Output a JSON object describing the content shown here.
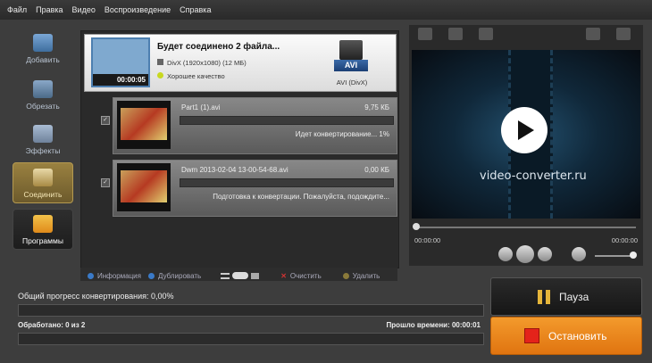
{
  "menu": [
    "Файл",
    "Правка",
    "Видео",
    "Воспроизведение",
    "Справка"
  ],
  "sidebar": {
    "items": [
      {
        "label": "Добавить",
        "icon": "add-video-icon"
      },
      {
        "label": "Обрезать",
        "icon": "cut-icon"
      },
      {
        "label": "Эффекты",
        "icon": "effects-icon"
      },
      {
        "label": "Соединить",
        "icon": "join-icon",
        "active": true
      },
      {
        "label": "Программы",
        "icon": "programs-icon"
      }
    ]
  },
  "group": {
    "title": "Будет соединено 2 файла...",
    "format_line": "DivX (1920x1080) (12 МБ)",
    "quality": "Хорошее качество",
    "thumb_time": "00:00:05",
    "profile_badge": "AVI",
    "profile_label": "AVI (DivX)"
  },
  "files": [
    {
      "name": "Part1 (1).avi",
      "size": "9,75 КБ",
      "status": "Идет конвертирование... 1%",
      "progress": 0.01
    },
    {
      "name": "Dwm 2013-02-04 13-00-54-68.avi",
      "size": "0,00 КБ",
      "status": "Подготовка к конвертации. Пожалуйста, подождите...",
      "progress": 0
    }
  ],
  "file_toolbar": {
    "info": "Информация",
    "duplicate": "Дублировать",
    "clear": "Очистить",
    "delete": "Удалить"
  },
  "preview": {
    "watermark": "video-converter.ru",
    "time_start": "00:00:00",
    "time_end": "00:00:00"
  },
  "progress": {
    "overall": "Общий прогресс конвертирования: 0,00%",
    "processed": "Обработано: 0 из 2",
    "elapsed": "Прошло времени: 00:00:01"
  },
  "buttons": {
    "pause": "Пауза",
    "stop": "Остановить"
  },
  "colors": {
    "accent_orange": "#f39a2c",
    "stop_red": "#e4231a",
    "pause_yellow": "#e5b53a",
    "active_gold": "#9a8140"
  }
}
